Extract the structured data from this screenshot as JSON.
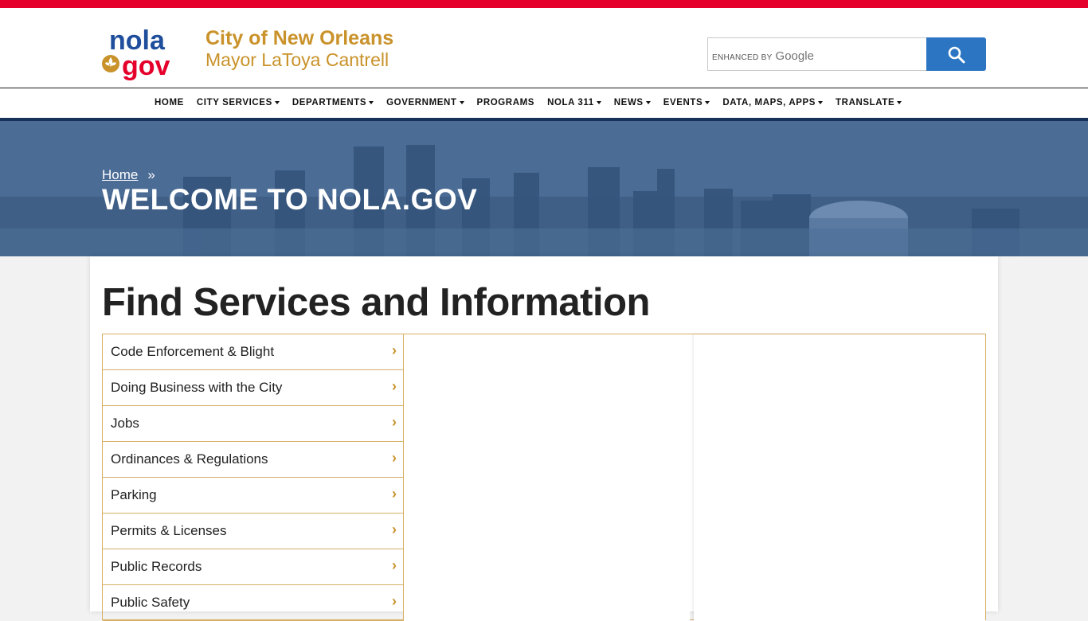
{
  "header": {
    "logo_top": "nola",
    "logo_bottom": "gov",
    "title": "City of New Orleans",
    "subtitle": "Mayor LaToya Cantrell"
  },
  "search": {
    "enhanced_label": "ENHANCED BY",
    "google_label": "Google",
    "button_icon": "search-icon"
  },
  "nav": {
    "items": [
      {
        "label": "HOME",
        "dropdown": false
      },
      {
        "label": "CITY SERVICES",
        "dropdown": true
      },
      {
        "label": "DEPARTMENTS",
        "dropdown": true
      },
      {
        "label": "GOVERNMENT",
        "dropdown": true
      },
      {
        "label": "PROGRAMS",
        "dropdown": false
      },
      {
        "label": "NOLA 311",
        "dropdown": true
      },
      {
        "label": "NEWS",
        "dropdown": true
      },
      {
        "label": "EVENTS",
        "dropdown": true
      },
      {
        "label": "DATA, MAPS, APPS",
        "dropdown": true
      },
      {
        "label": "TRANSLATE",
        "dropdown": true
      }
    ]
  },
  "hero": {
    "breadcrumb_home": "Home",
    "breadcrumb_sep": "»",
    "title": "WELCOME TO NOLA.GOV"
  },
  "services": {
    "title": "Find Services and Information",
    "chevron": "›",
    "items": [
      "Code Enforcement & Blight",
      "Doing Business with the City",
      "Jobs",
      "Ordinances & Regulations",
      "Parking",
      "Permits & Licenses",
      "Public Records",
      "Public Safety"
    ]
  },
  "colors": {
    "top_bar": "#e4002b",
    "gold": "#c9922a",
    "logo_blue": "#1f4e9c",
    "search_button": "#2c75c3",
    "nav_border": "#17315a",
    "hero_blue": "#4b6d96"
  }
}
